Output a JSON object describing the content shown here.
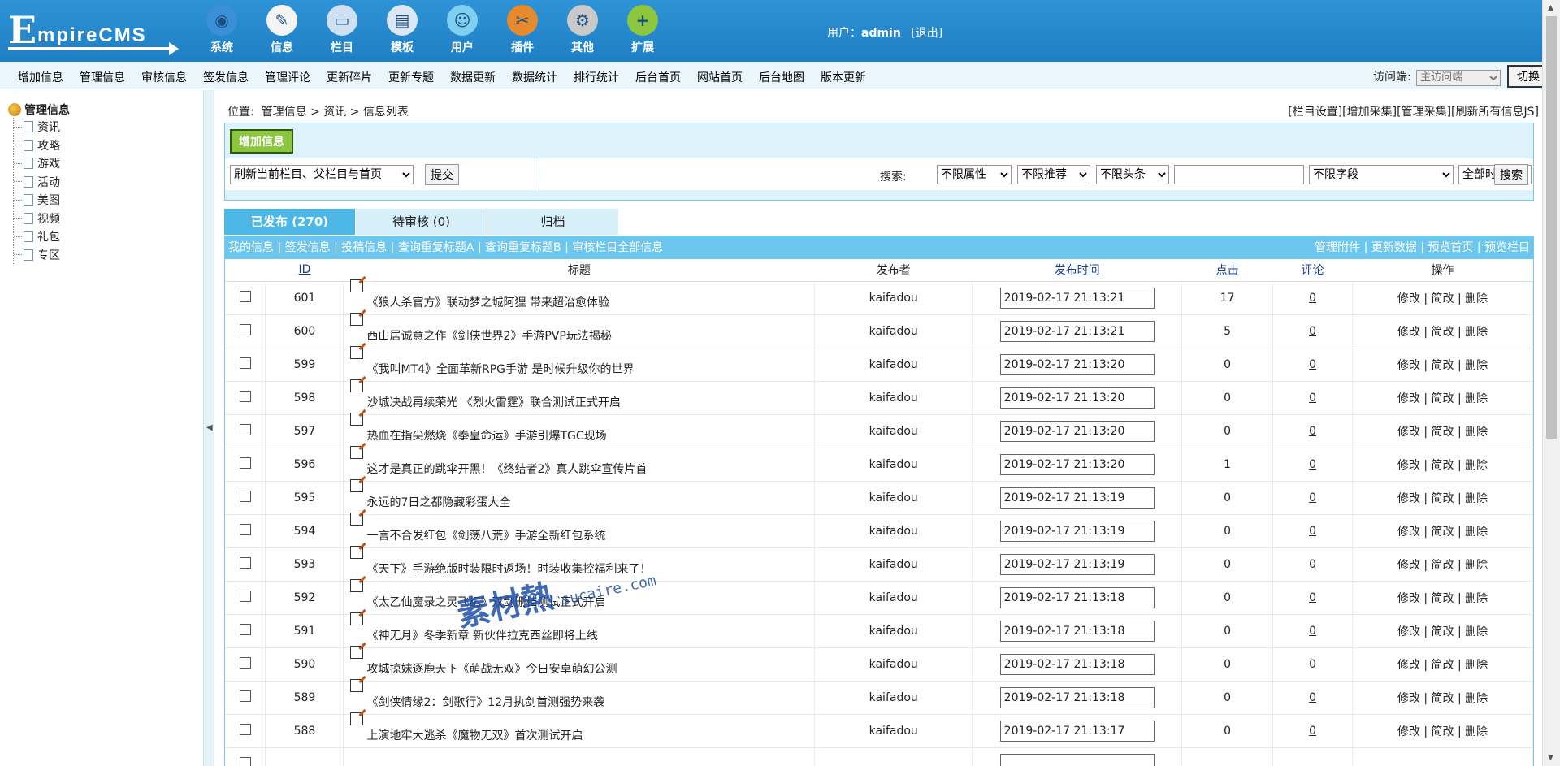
{
  "logo": {
    "first": "E",
    "rest": "mpireCMS"
  },
  "topnav": [
    {
      "label": "系统",
      "icon": "globe-icon",
      "color": "#3a8fd6"
    },
    {
      "label": "信息",
      "icon": "document-edit-icon",
      "color": "#f4f4f4"
    },
    {
      "label": "栏目",
      "icon": "folder-icon",
      "color": "#cfe0f2"
    },
    {
      "label": "模板",
      "icon": "window-template-icon",
      "color": "#dbe7f4"
    },
    {
      "label": "用户",
      "icon": "user-icon",
      "color": "#7fd0f0"
    },
    {
      "label": "插件",
      "icon": "tools-icon",
      "color": "#e68a2e"
    },
    {
      "label": "其他",
      "icon": "gear-icon",
      "color": "#c9c9c9"
    },
    {
      "label": "扩展",
      "icon": "plus-icon",
      "color": "#8cc63f"
    }
  ],
  "user": {
    "label": "用户：",
    "name": "admin",
    "logout": "[退出]"
  },
  "menu": [
    "增加信息",
    "管理信息",
    "审核信息",
    "签发信息",
    "管理评论",
    "更新碎片",
    "更新专题",
    "数据更新",
    "数据统计",
    "排行统计",
    "后台首页",
    "网站首页",
    "后台地图",
    "版本更新"
  ],
  "visit": {
    "label": "访问端:",
    "selected": "主访问端",
    "switch": "切换"
  },
  "tree": {
    "root": "管理信息",
    "items": [
      "资讯",
      "攻略",
      "游戏",
      "活动",
      "美图",
      "视频",
      "礼包",
      "专区"
    ]
  },
  "crumb": {
    "prefix": "位置:",
    "path": "管理信息 > 资讯 > 信息列表"
  },
  "crumb_links": [
    "[栏目设置]",
    "[增加采集]",
    "[管理采集]",
    "[刷新所有信息JS]"
  ],
  "panel": {
    "add_btn": "增加信息",
    "refresh_select": "刷新当前栏目、父栏目与首页",
    "submit": "提交",
    "search_label": "搜索:",
    "attr": "不限属性",
    "recommend": "不限推荐",
    "headline": "不限头条",
    "keyword": "",
    "field": "不限字段",
    "time": "全部时间",
    "search_btn": "搜索"
  },
  "tabs": [
    "已发布 (270)",
    "待审核 (0)",
    "归档"
  ],
  "list_links_left": "我的信息 | 签发信息 | 投稿信息 | 查询重复标题A | 查询重复标题B | 审核栏目全部信息",
  "list_links_right": "管理附件 | 更新数据 | 预览首页 | 预览栏目",
  "columns": {
    "id": "ID",
    "title": "标题",
    "author": "发布者",
    "time": "发布时间",
    "clicks": "点击",
    "comments": "评论",
    "ops": "操作"
  },
  "ops": {
    "edit": "修改",
    "quick": "简改",
    "del": "删除",
    "sep": " | "
  },
  "rows": [
    {
      "id": "601",
      "title": "《狼人杀官方》联动梦之城阿狸 带来超治愈体验",
      "author": "kaifadou",
      "time": "2019-02-17 21:13:21",
      "clicks": "17",
      "comments": "0"
    },
    {
      "id": "600",
      "title": "西山居诚意之作《剑侠世界2》手游PVP玩法揭秘",
      "author": "kaifadou",
      "time": "2019-02-17 21:13:21",
      "clicks": "5",
      "comments": "0"
    },
    {
      "id": "599",
      "title": "《我叫MT4》全面革新RPG手游 是时候升级你的世界",
      "author": "kaifadou",
      "time": "2019-02-17 21:13:20",
      "clicks": "0",
      "comments": "0"
    },
    {
      "id": "598",
      "title": "沙城决战再续荣光 《烈火雷霆》联合测试正式开启",
      "author": "kaifadou",
      "time": "2019-02-17 21:13:20",
      "clicks": "0",
      "comments": "0"
    },
    {
      "id": "597",
      "title": "热血在指尖燃烧《拳皇命运》手游引爆TGC现场",
      "author": "kaifadou",
      "time": "2019-02-17 21:13:20",
      "clicks": "0",
      "comments": "0"
    },
    {
      "id": "596",
      "title": "这才是真正的跳伞开黑！《终结者2》真人跳伞宣传片首",
      "author": "kaifadou",
      "time": "2019-02-17 21:13:20",
      "clicks": "1",
      "comments": "0"
    },
    {
      "id": "595",
      "title": "永远的7日之都隐藏彩蛋大全",
      "author": "kaifadou",
      "time": "2019-02-17 21:13:19",
      "clicks": "0",
      "comments": "0"
    },
    {
      "id": "594",
      "title": "一言不合发红包《剑荡八荒》手游全新红包系统",
      "author": "kaifadou",
      "time": "2019-02-17 21:13:19",
      "clicks": "0",
      "comments": "0"
    },
    {
      "id": "593",
      "title": "《天下》手游绝版时装限时返场！时装收集控福利来了！",
      "author": "kaifadou",
      "time": "2019-02-17 21:13:19",
      "clicks": "0",
      "comments": "0"
    },
    {
      "id": "592",
      "title": "《太乙仙魔录之灵飞纪》双剑删档测试正式开启",
      "author": "kaifadou",
      "time": "2019-02-17 21:13:18",
      "clicks": "0",
      "comments": "0"
    },
    {
      "id": "591",
      "title": "《神无月》冬季新章 新伙伴拉克西丝即将上线",
      "author": "kaifadou",
      "time": "2019-02-17 21:13:18",
      "clicks": "0",
      "comments": "0"
    },
    {
      "id": "590",
      "title": "攻城掠妹逐鹿天下《萌战无双》今日安卓萌幻公测",
      "author": "kaifadou",
      "time": "2019-02-17 21:13:18",
      "clicks": "0",
      "comments": "0"
    },
    {
      "id": "589",
      "title": "《剑侠情缘2：剑歌行》12月执剑首测强势来袭",
      "author": "kaifadou",
      "time": "2019-02-17 21:13:18",
      "clicks": "0",
      "comments": "0"
    },
    {
      "id": "588",
      "title": "上演地牢大逃杀《魔物无双》首次测试开启",
      "author": "kaifadou",
      "time": "2019-02-17 21:13:17",
      "clicks": "0",
      "comments": "0"
    },
    {
      "id": "",
      "title": "",
      "author": "",
      "time": "",
      "clicks": "",
      "comments": ""
    }
  ],
  "watermark": {
    "cn": "素材熱",
    "en": "sucaire.com"
  }
}
